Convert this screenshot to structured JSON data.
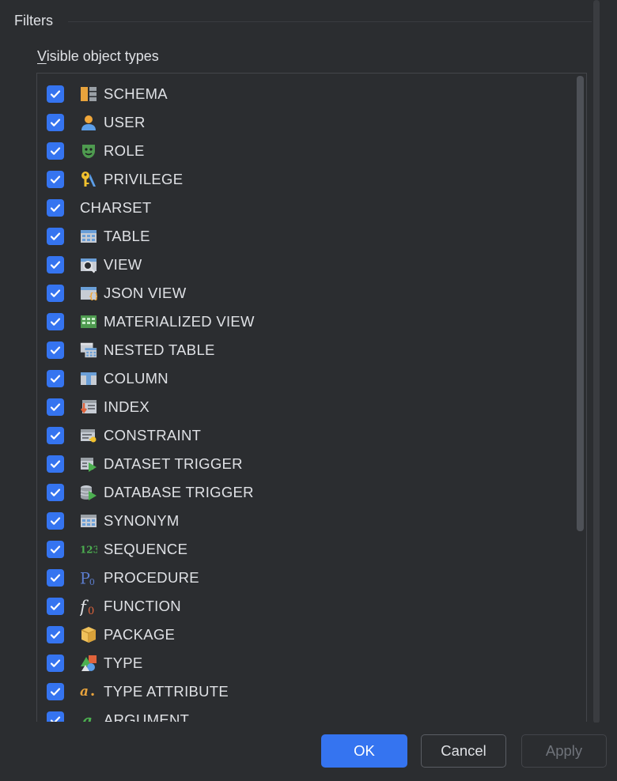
{
  "section_title": "Filters",
  "group_label_mnemonic": "V",
  "group_label_rest": "isible object types",
  "items": [
    {
      "label": "SCHEMA",
      "icon": "schema-icon",
      "checked": true
    },
    {
      "label": "USER",
      "icon": "user-icon",
      "checked": true
    },
    {
      "label": "ROLE",
      "icon": "role-icon",
      "checked": true
    },
    {
      "label": "PRIVILEGE",
      "icon": "privilege-icon",
      "checked": true
    },
    {
      "label": "CHARSET",
      "icon": "",
      "checked": true
    },
    {
      "label": "TABLE",
      "icon": "table-icon",
      "checked": true
    },
    {
      "label": "VIEW",
      "icon": "view-icon",
      "checked": true
    },
    {
      "label": "JSON VIEW",
      "icon": "json-view-icon",
      "checked": true
    },
    {
      "label": "MATERIALIZED VIEW",
      "icon": "materialized-view-icon",
      "checked": true
    },
    {
      "label": "NESTED TABLE",
      "icon": "nested-table-icon",
      "checked": true
    },
    {
      "label": "COLUMN",
      "icon": "column-icon",
      "checked": true
    },
    {
      "label": "INDEX",
      "icon": "index-icon",
      "checked": true
    },
    {
      "label": "CONSTRAINT",
      "icon": "constraint-icon",
      "checked": true
    },
    {
      "label": "DATASET TRIGGER",
      "icon": "dataset-trigger-icon",
      "checked": true
    },
    {
      "label": "DATABASE TRIGGER",
      "icon": "database-trigger-icon",
      "checked": true
    },
    {
      "label": "SYNONYM",
      "icon": "synonym-icon",
      "checked": true
    },
    {
      "label": "SEQUENCE",
      "icon": "sequence-icon",
      "checked": true
    },
    {
      "label": "PROCEDURE",
      "icon": "procedure-icon",
      "checked": true
    },
    {
      "label": "FUNCTION",
      "icon": "function-icon",
      "checked": true
    },
    {
      "label": "PACKAGE",
      "icon": "package-icon",
      "checked": true
    },
    {
      "label": "TYPE",
      "icon": "type-icon",
      "checked": true
    },
    {
      "label": "TYPE ATTRIBUTE",
      "icon": "type-attribute-icon",
      "checked": true
    },
    {
      "label": "ARGUMENT",
      "icon": "argument-icon",
      "checked": true
    }
  ],
  "buttons": {
    "ok": "OK",
    "cancel": "Cancel",
    "apply": "Apply"
  },
  "colors": {
    "accent": "#3574f0",
    "background": "#2b2d30",
    "text": "#dfe1e5",
    "disabled_text": "#6f737a"
  }
}
